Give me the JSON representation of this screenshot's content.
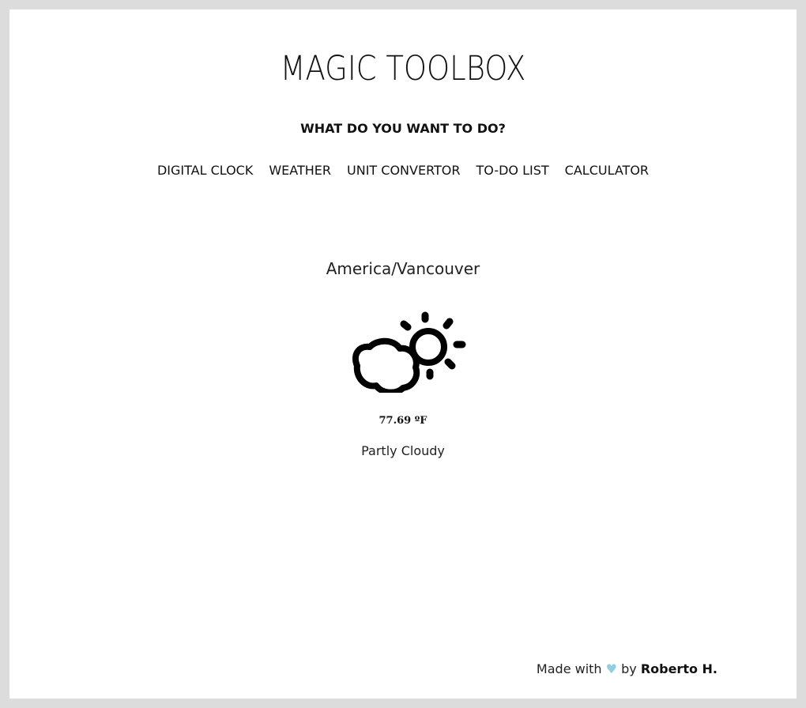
{
  "header": {
    "title": "MAGIC TOOLBOX",
    "question": "WHAT DO YOU WANT TO DO?"
  },
  "nav": {
    "items": [
      {
        "label": "DIGITAL CLOCK"
      },
      {
        "label": "WEATHER"
      },
      {
        "label": "UNIT CONVERTOR"
      },
      {
        "label": "TO-DO LIST"
      },
      {
        "label": "CALCULATOR"
      }
    ]
  },
  "weather": {
    "location": "America/Vancouver",
    "icon": "partly-cloudy-icon",
    "temperature": "77.69 ºF",
    "condition": "Partly Cloudy"
  },
  "footer": {
    "made_with": "Made with",
    "heart": "♥",
    "by": "by",
    "author": "Roberto H",
    "period": "."
  },
  "colors": {
    "heart": "#8fcfe0",
    "background": "#dcdcdc",
    "panel": "#ffffff"
  }
}
